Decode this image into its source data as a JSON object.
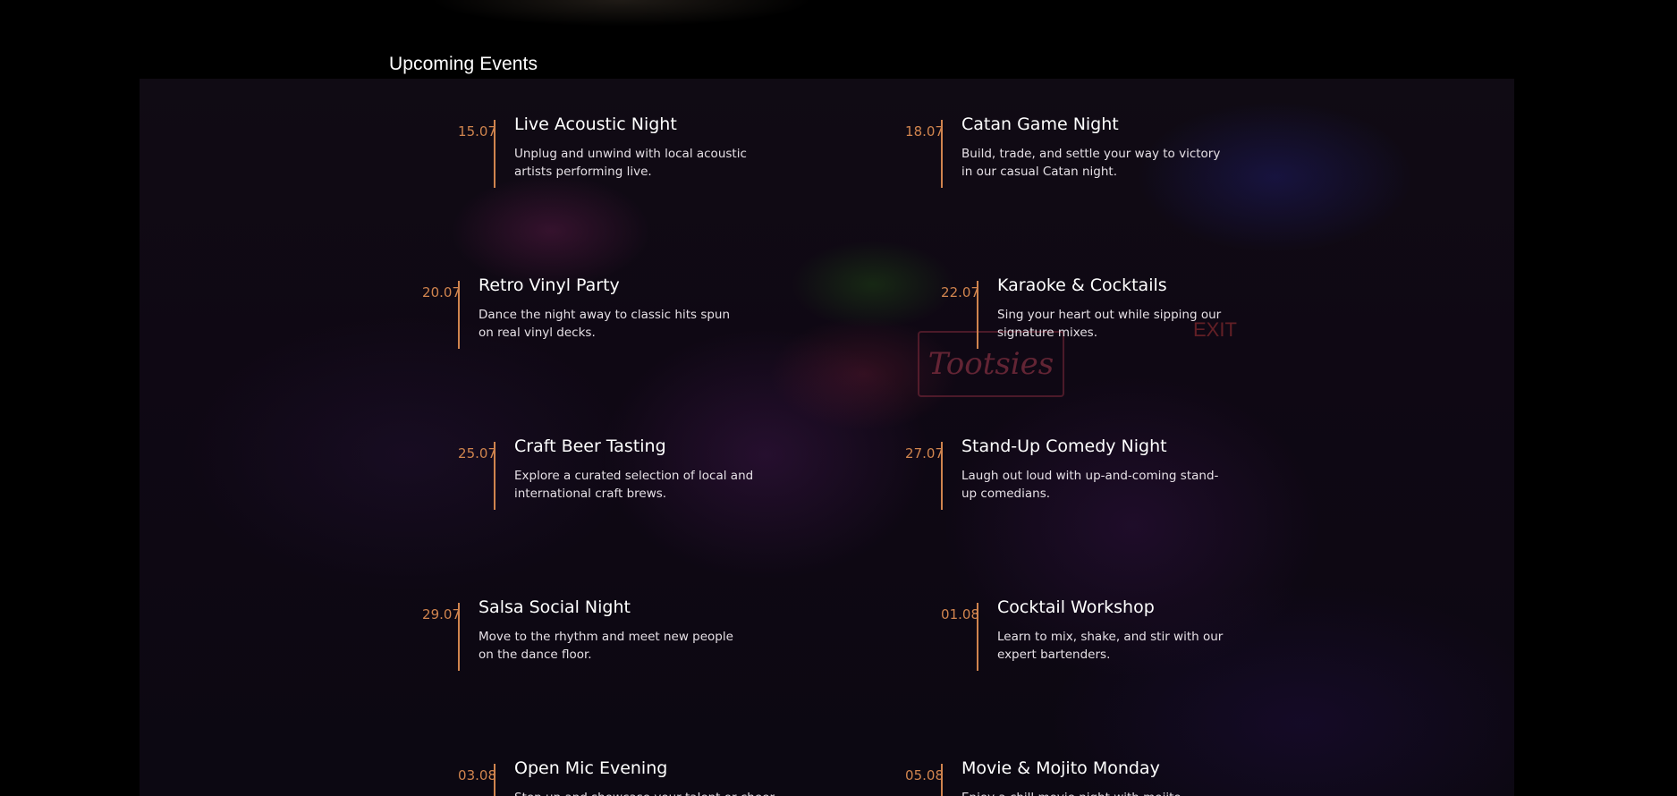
{
  "section": {
    "title": "Upcoming Events"
  },
  "colors": {
    "accent": "#d0844e",
    "background": "#000000",
    "text": "#ffffff"
  },
  "background_image": {
    "neon_text": "Tootsies",
    "exit_text": "EXIT"
  },
  "events": [
    {
      "date": "15.07",
      "title": "Live Acoustic Night",
      "description": "Unplug and unwind with local acoustic artists performing live."
    },
    {
      "date": "18.07",
      "title": "Catan Game Night",
      "description": "Build, trade, and settle your way to victory in our casual Catan night."
    },
    {
      "date": "20.07",
      "title": "Retro Vinyl Party",
      "description": "Dance the night away to classic hits spun on real vinyl decks."
    },
    {
      "date": "22.07",
      "title": "Karaoke & Cocktails",
      "description": "Sing your heart out while sipping our signature mixes."
    },
    {
      "date": "25.07",
      "title": "Craft Beer Tasting",
      "description": "Explore a curated selection of local and international craft brews."
    },
    {
      "date": "27.07",
      "title": "Stand-Up Comedy Night",
      "description": "Laugh out loud with up-and-coming stand-up comedians."
    },
    {
      "date": "29.07",
      "title": "Salsa Social Night",
      "description": "Move to the rhythm and meet new people on the dance floor."
    },
    {
      "date": "01.08",
      "title": "Cocktail Workshop",
      "description": "Learn to mix, shake, and stir with our expert bartenders."
    },
    {
      "date": "03.08",
      "title": "Open Mic Evening",
      "description": "Step up and showcase your talent or cheer on"
    },
    {
      "date": "05.08",
      "title": "Movie & Mojito Monday",
      "description": "Enjoy a chill movie night with mojito specials all"
    }
  ]
}
